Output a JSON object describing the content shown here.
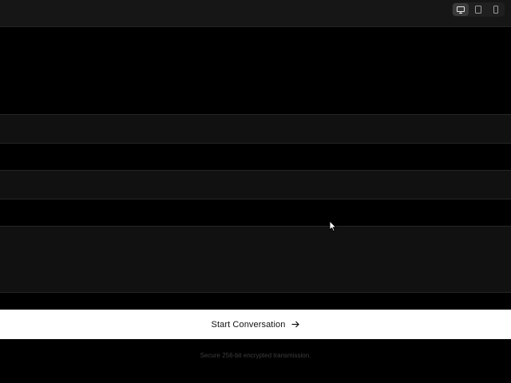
{
  "toolbar": {
    "devices": [
      {
        "icon": "desktop-icon",
        "active": true
      },
      {
        "icon": "tablet-icon",
        "active": false
      },
      {
        "icon": "mobile-icon",
        "active": false
      }
    ]
  },
  "form": {
    "fields": [
      {
        "value": ""
      },
      {
        "value": ""
      },
      {
        "value": ""
      }
    ],
    "submit_label": "Start Conversation",
    "submit_icon": "arrow-right-icon",
    "footnote": "Secure 256-bit encrypted transmission."
  },
  "colors": {
    "background": "#000000",
    "field_background": "#111111",
    "button_background": "#ffffff",
    "button_text": "#111111"
  }
}
